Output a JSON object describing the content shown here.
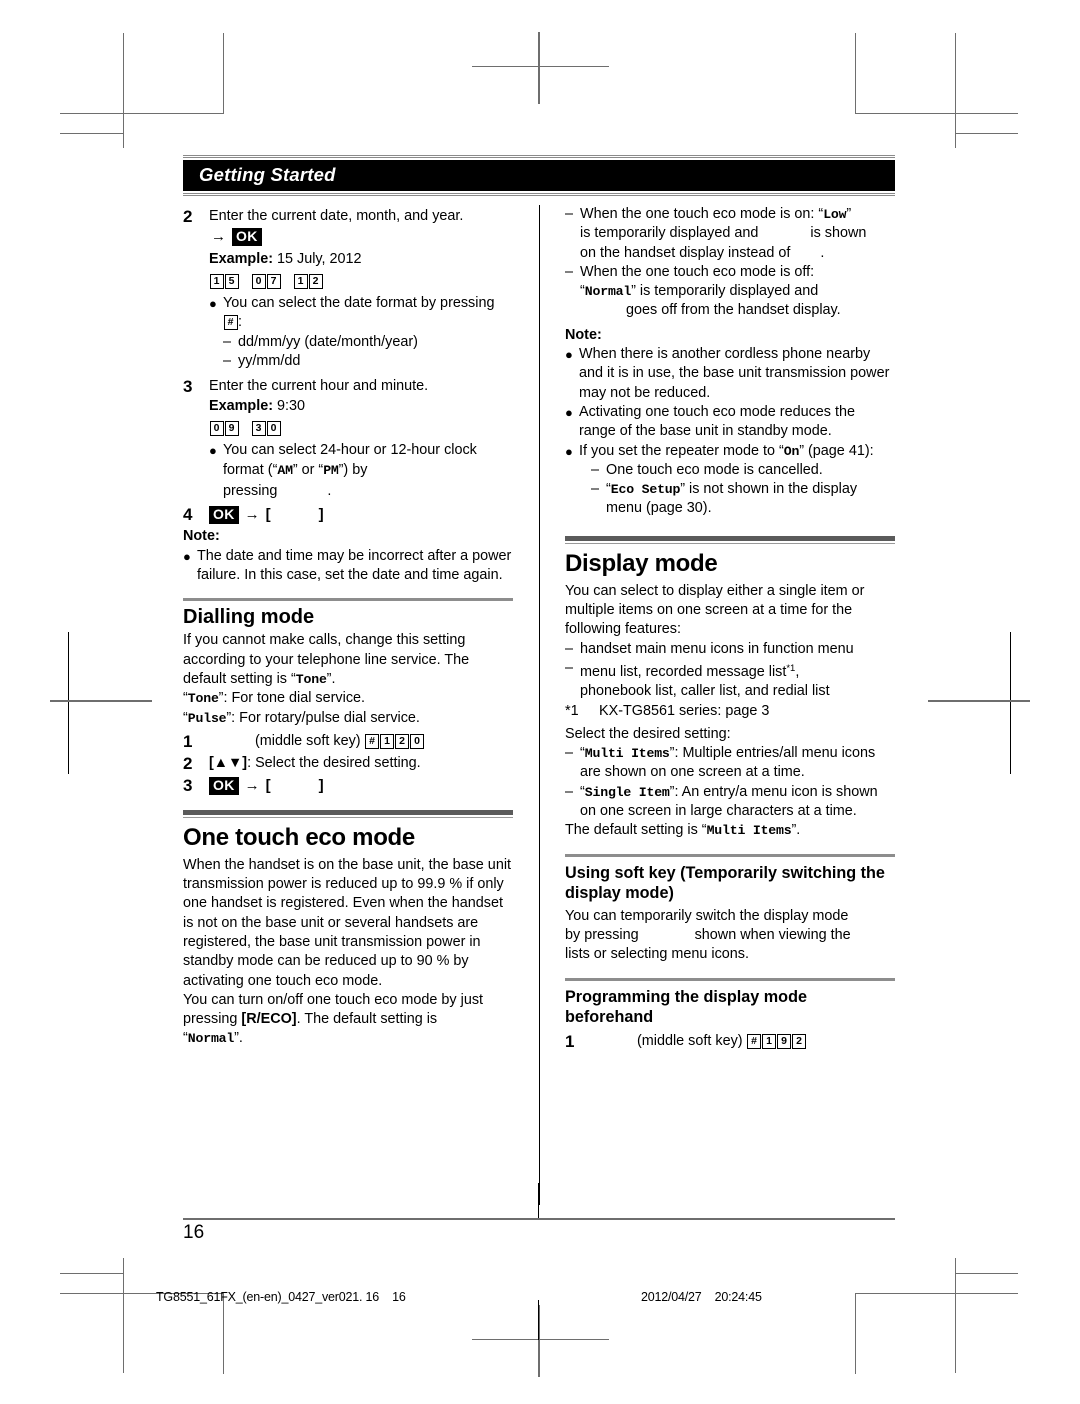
{
  "header": {
    "title": "Getting Started"
  },
  "page_number": "16",
  "footer": {
    "left": "TG8551_61FX_(en-en)_0427_ver021. 16    16",
    "right": "2012/04/27    20:24:45"
  },
  "left_column": {
    "step2": {
      "num": "2",
      "text": "Enter the current date, month, and year.",
      "arrow": "→",
      "ok_key": "OK",
      "example_label": "Example:",
      "example_value": "15 July, 2012",
      "keys": [
        "1",
        "5",
        "0",
        "7",
        "1",
        "2"
      ],
      "bullet": "You can select the date format by pressing",
      "bullet_key": "#",
      "bullet_tail": ":",
      "dashes": [
        "dd/mm/yy (date/month/year)",
        "yy/mm/dd"
      ]
    },
    "step3": {
      "num": "3",
      "text": "Enter the current hour and minute.",
      "example_label": "Example:",
      "example_value": "9:30",
      "keys": [
        "0",
        "9",
        "3",
        "0"
      ],
      "bullet_pre": "You can select 24-hour or 12-hour clock format (“",
      "bullet_am": "AM",
      "bullet_mid": "” or “",
      "bullet_pm": "PM",
      "bullet_post": "”) by",
      "bullet_line2_pre": "pressing",
      "bullet_line2_post": "."
    },
    "step4": {
      "num": "4",
      "ok_key": "OK",
      "arrow": "→",
      "bracket_open": "[",
      "bracket_close": "]"
    },
    "note_label": "Note:",
    "note_bullet": "The date and time may be incorrect after a power failure. In this case, set the date and time again.",
    "dialling": {
      "title": "Dialling mode",
      "intro_pre": "If you cannot make calls, change this setting according to your telephone line service. The default setting is “",
      "intro_mono": "Tone",
      "intro_post": "”.",
      "tone_mono": "Tone",
      "tone_text": "”: For tone dial service.",
      "pulse_mono": "Pulse",
      "pulse_text": "”: For rotary/pulse dial service.",
      "step1_num": "1",
      "step1_text": "(middle soft key)",
      "step1_keys": [
        "#",
        "1",
        "2",
        "0"
      ],
      "step2_num": "2",
      "step2_text": ": Select the desired setting.",
      "step3_num": "3",
      "step3_ok": "OK",
      "step3_arrow": "→",
      "bracket_open": "[",
      "bracket_close": "]"
    },
    "eco": {
      "title": "One touch eco mode",
      "para1": "When the handset is on the base unit, the base unit transmission power is reduced up to 99.9 % if only one handset is registered. Even when the handset is not on the base unit or several handsets are registered, the base unit transmission power in standby mode can be reduced up to 90 % by activating one touch eco mode.",
      "para2_pre": "You can turn on/off one touch eco mode by just pressing ",
      "para2_key": "[R/ECO]",
      "para2_mid": ". The default setting is",
      "para2_mono": "Normal",
      "para2_post": "”."
    }
  },
  "right_column": {
    "eco_dashes": {
      "d1_pre": "When the one touch eco mode is on: “",
      "d1_mono": "Low",
      "d1_post": "”",
      "d1_l2a": "is temporarily displayed and",
      "d1_l2b": "is shown",
      "d1_l3a": "on the handset display instead of",
      "d1_l3b": ".",
      "d2_l1": "When the one touch eco mode is off:",
      "d2_mono": "Normal",
      "d2_l2post": "” is temporarily displayed and",
      "d2_l3": "goes off from the handset display."
    },
    "note_label": "Note:",
    "note_bullets": [
      "When there is another cordless phone nearby and it is in use, the base unit transmission power may not be reduced.",
      "Activating one touch eco mode reduces the range of the base unit in standby mode."
    ],
    "note_repeater_pre": "If you set the repeater mode to “",
    "note_repeater_mono": "On",
    "note_repeater_post": "” (page 41):",
    "note_repeater_dashes": [
      {
        "pre": "One touch eco mode is cancelled.",
        "mono": "",
        "post": ""
      },
      {
        "pre": "“",
        "mono": "Eco Setup",
        "post": "” is not shown in the display menu (page 30)."
      }
    ],
    "display": {
      "title": "Display mode",
      "intro": "You can select to display either a single item or multiple items on one screen at a time for the following features:",
      "dash1": "handset main menu icons in function menu",
      "dash2a": "menu list, recorded message list",
      "dash2_sup": "*1",
      "dash2b": ",",
      "dash2c": "phonebook list, caller list, and redial list",
      "footnote_mark": "*1",
      "footnote_text": "KX-TG8561 series: page 3",
      "select_label": "Select the desired setting:",
      "opt1_mono": "Multi Items",
      "opt1_text": "”: Multiple entries/all menu icons are shown on one screen at a time.",
      "opt2_mono": "Single Item",
      "opt2_text": "”: An entry/a menu icon is shown on one screen in large characters at a time.",
      "default_pre": "The default setting is “",
      "default_mono": "Multi Items",
      "default_post": "”."
    },
    "softkey": {
      "title": "Using soft key (Temporarily switching the display mode)",
      "l1": "You can temporarily switch the display mode",
      "l2a": "by pressing",
      "l2b": "shown when viewing the",
      "l3": "lists or selecting menu icons."
    },
    "programming": {
      "title": "Programming the display mode beforehand",
      "step1_num": "1",
      "step1_text": "(middle soft key)",
      "step1_keys": [
        "#",
        "1",
        "9",
        "2"
      ]
    }
  }
}
